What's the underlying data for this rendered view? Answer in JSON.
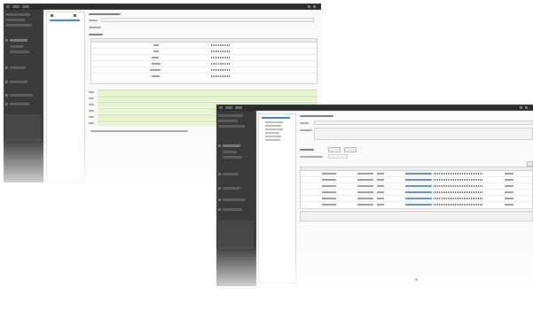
{
  "screens": [
    {
      "id": "front",
      "green_rows": 6
    },
    {
      "id": "back",
      "table_rows": 7
    }
  ],
  "colors": {
    "titlebar": "#2b2b2b",
    "sidebar": "#3a3a3a",
    "selection": "#3e7fd6",
    "status_green": "#e6f3cf",
    "link": "#5b8fd8"
  }
}
